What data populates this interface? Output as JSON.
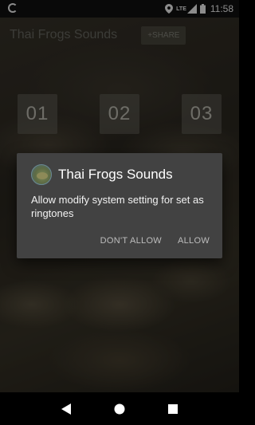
{
  "status_bar": {
    "network_label": "LTE",
    "time": "11:58",
    "icons": [
      "google-icon",
      "location-icon",
      "signal-icon",
      "battery-icon"
    ]
  },
  "app": {
    "title": "Thai Frogs Sounds",
    "share_label": "+SHARE",
    "sound_buttons": [
      "01",
      "02",
      "03"
    ]
  },
  "dialog": {
    "title": "Thai Frogs Sounds",
    "message": "Allow modify system setting for set as ringtones",
    "deny_label": "DON'T ALLOW",
    "allow_label": "ALLOW"
  },
  "nav_bar": {
    "icons": [
      "back-icon",
      "home-icon",
      "recents-icon"
    ]
  },
  "colors": {
    "dialog_bg": "#424242",
    "status_bar_bg": "#121212",
    "dialog_button_text": "#bdbdbd"
  }
}
